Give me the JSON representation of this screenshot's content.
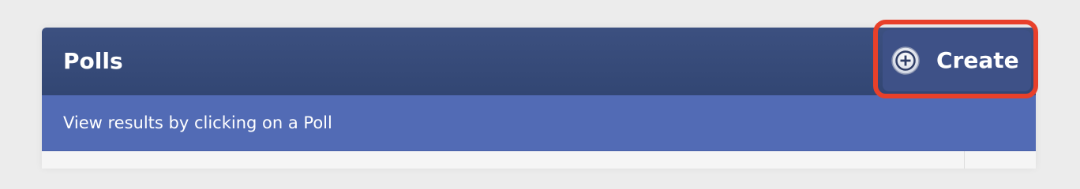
{
  "panel": {
    "title": "Polls",
    "subtitle": "View results by clicking on a Poll",
    "create_button": {
      "label": "Create",
      "icon": "plus-circle-icon"
    }
  },
  "colors": {
    "header": "#3a4d7e",
    "subheader": "#526bb5",
    "highlight": "#e8402a",
    "background": "#ececec"
  }
}
